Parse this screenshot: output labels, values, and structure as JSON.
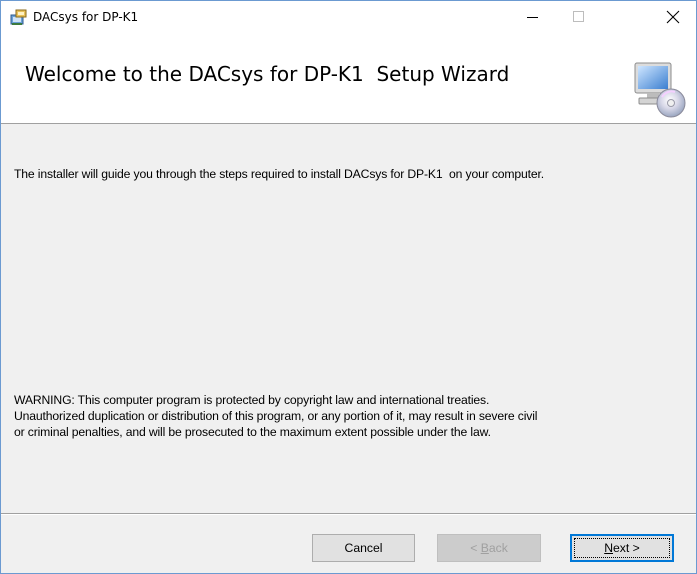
{
  "window": {
    "title": "DACsys for DP-K1",
    "controls": {
      "minimize": "—",
      "maximize": "□",
      "close": "✕"
    }
  },
  "banner": {
    "title": "Welcome to the DACsys for DP-K1  Setup Wizard",
    "icon": "computer-cd-icon"
  },
  "content": {
    "intro": "The installer will guide you through the steps required to install DACsys for DP-K1  on your computer.",
    "warning_lines": [
      "WARNING: This computer program is protected by copyright law and international treaties.",
      "Unauthorized duplication or distribution of this program, or any portion of it, may result in severe civil",
      "or criminal penalties, and will be prosecuted to the maximum extent possible under the law."
    ]
  },
  "buttons": {
    "cancel": "Cancel",
    "back_prefix": "< ",
    "back_mnemonic": "B",
    "back_rest": "ack",
    "next_mnemonic": "N",
    "next_rest": "ext >"
  },
  "colors": {
    "accent": "#0078d7",
    "disabled_text": "#a0a0a0",
    "window_border": "#6b9ad1"
  }
}
